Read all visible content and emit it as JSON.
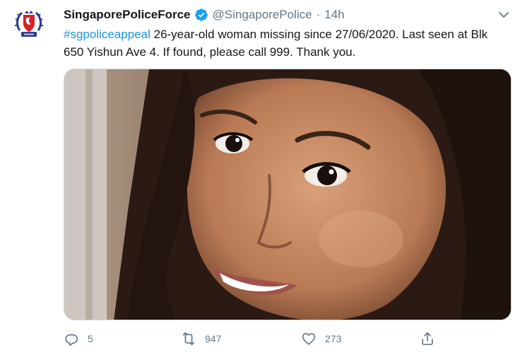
{
  "tweet": {
    "author": {
      "display_name": "SingaporePoliceForce",
      "handle": "@SingaporePolice",
      "verified": true,
      "avatar_icon": "police-crest-icon"
    },
    "separator": "·",
    "time": "14h",
    "text": {
      "hashtag": "#sgpoliceappeal",
      "body": " 26-year-old woman missing since 27/06/2020. Last seen at Blk 650 Yishun Ave 4. If found, please call 999. Thank you."
    },
    "actions": {
      "reply_count": "5",
      "retweet_count": "947",
      "like_count": "273"
    },
    "colors": {
      "link": "#1b95e0",
      "verified": "#1da1f2",
      "muted": "#657786"
    }
  }
}
